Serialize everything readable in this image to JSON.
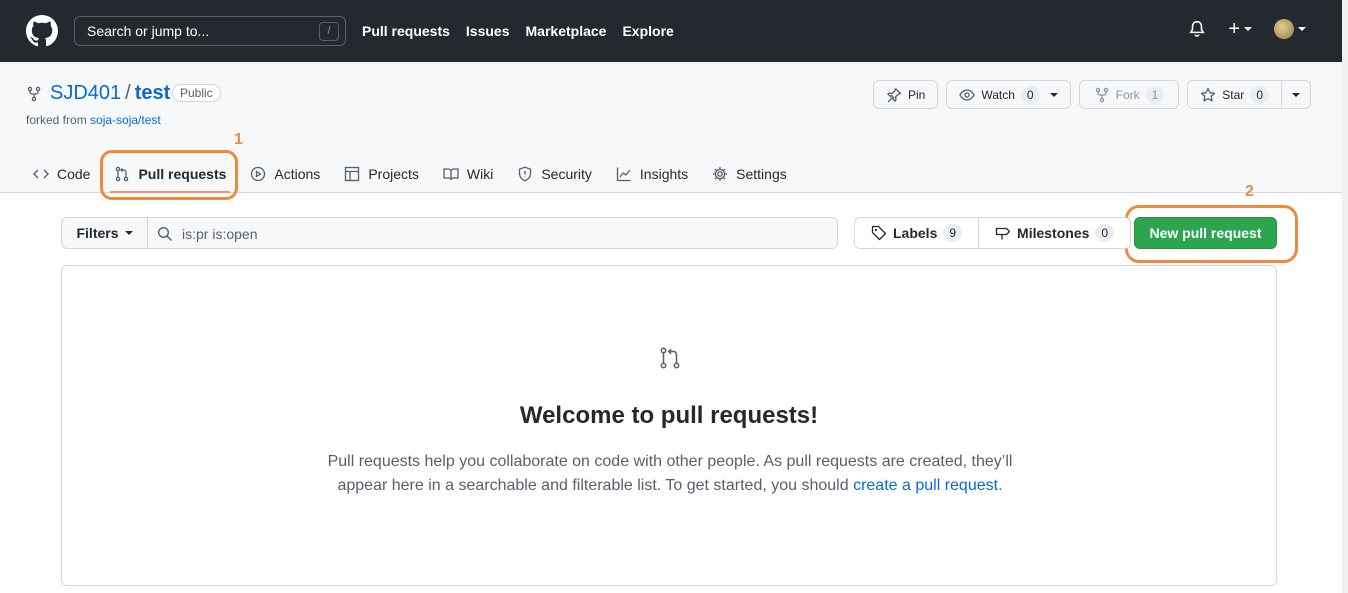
{
  "header": {
    "search_placeholder": "Search or jump to...",
    "search_shortcut": "/",
    "nav": [
      "Pull requests",
      "Issues",
      "Marketplace",
      "Explore"
    ],
    "plus_label": "+"
  },
  "repo": {
    "owner": "SJD401",
    "separator": "/",
    "name": "test",
    "visibility": "Public",
    "forked_prefix": "forked from",
    "forked_source": "soja-soja/test",
    "actions": {
      "pin_label": "Pin",
      "watch_label": "Watch",
      "watch_count": "0",
      "fork_label": "Fork",
      "fork_count": "1",
      "star_label": "Star",
      "star_count": "0"
    }
  },
  "tabs": [
    {
      "label": "Code",
      "icon": "code-icon"
    },
    {
      "label": "Pull requests",
      "icon": "git-pull-request-icon",
      "active": true
    },
    {
      "label": "Actions",
      "icon": "play-icon"
    },
    {
      "label": "Projects",
      "icon": "table-icon"
    },
    {
      "label": "Wiki",
      "icon": "book-icon"
    },
    {
      "label": "Security",
      "icon": "shield-icon"
    },
    {
      "label": "Insights",
      "icon": "graph-icon"
    },
    {
      "label": "Settings",
      "icon": "gear-icon"
    }
  ],
  "annotations": {
    "step1": "1",
    "step2": "2",
    "color": "#f0883e"
  },
  "filters": {
    "button_label": "Filters",
    "query": "is:pr is:open",
    "labels_label": "Labels",
    "labels_count": "9",
    "milestones_label": "Milestones",
    "milestones_count": "0",
    "new_pr_label": "New pull request"
  },
  "blankslate": {
    "title": "Welcome to pull requests!",
    "text_line1": "Pull requests help you collaborate on code with other people. As pull requests are created, they’ll",
    "text_line2": "appear here in a searchable and filterable list. To get started, you should",
    "link": "create a pull request",
    "text_end": "."
  },
  "colors": {
    "brand_green": "#2da44e",
    "link_blue": "#0969da",
    "header_bg": "#24292f",
    "active_tab_underline": "#fd8c73"
  }
}
